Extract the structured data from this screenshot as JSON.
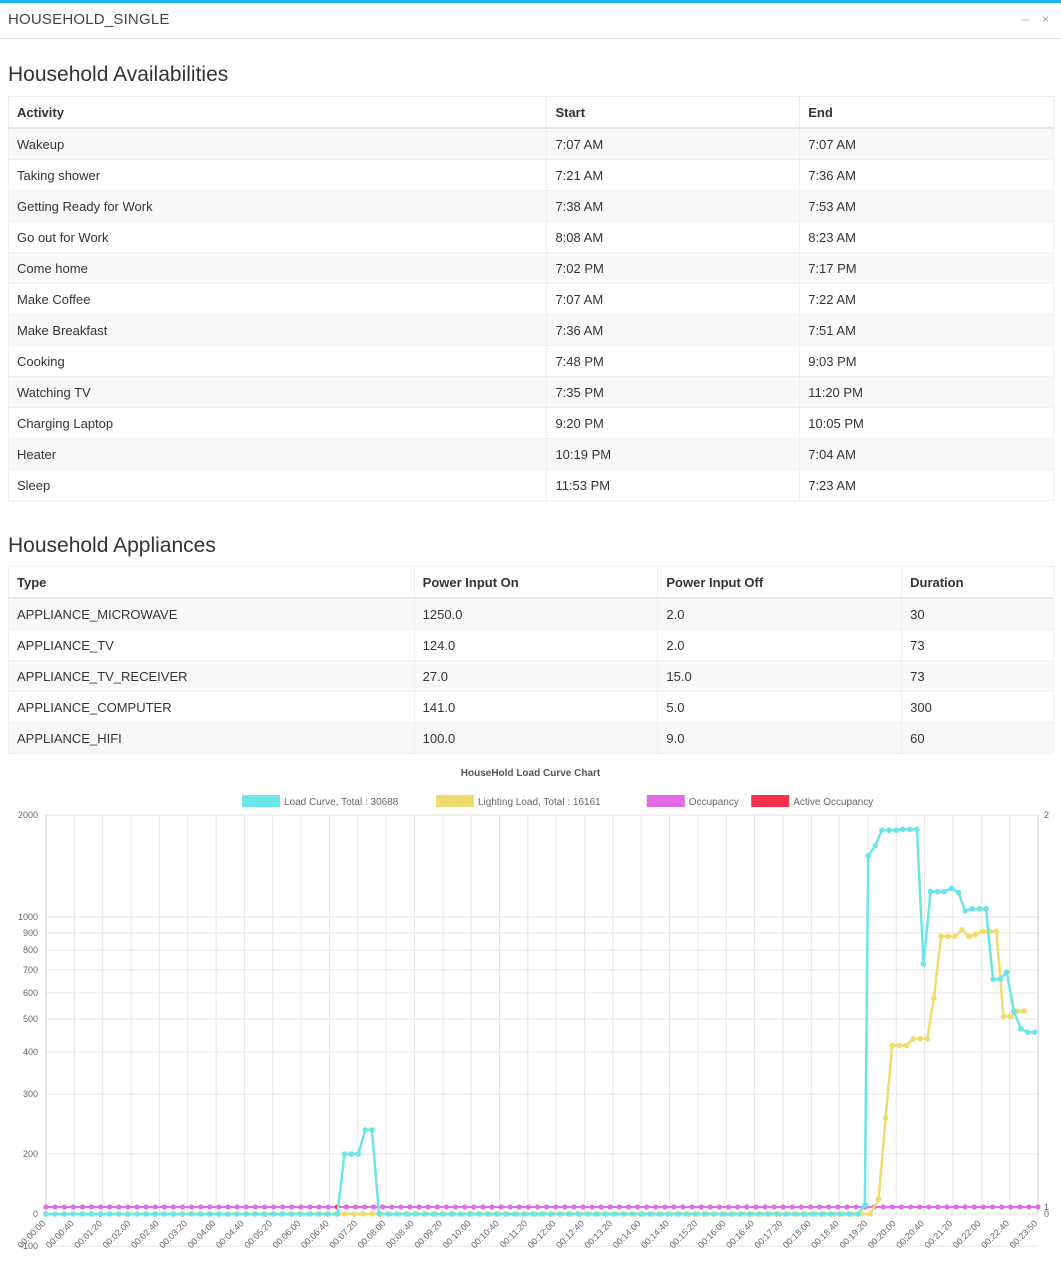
{
  "panel": {
    "title": "HOUSEHOLD_SINGLE",
    "minimize": "–",
    "close": "×"
  },
  "availabilities": {
    "heading": "Household Availabilities",
    "columns": [
      "Activity",
      "Start",
      "End"
    ],
    "rows": [
      [
        "Wakeup",
        "7:07 AM",
        "7:07 AM"
      ],
      [
        "Taking shower",
        "7:21 AM",
        "7:36 AM"
      ],
      [
        "Getting Ready for Work",
        "7:38 AM",
        "7:53 AM"
      ],
      [
        "Go out for Work",
        "8:08 AM",
        "8:23 AM"
      ],
      [
        "Come home",
        "7:02 PM",
        "7:17 PM"
      ],
      [
        "Make Coffee",
        "7:07 AM",
        "7:22 AM"
      ],
      [
        "Make Breakfast",
        "7:36 AM",
        "7:51 AM"
      ],
      [
        "Cooking",
        "7:48 PM",
        "9:03 PM"
      ],
      [
        "Watching TV",
        "7:35 PM",
        "11:20 PM"
      ],
      [
        "Charging Laptop",
        "9:20 PM",
        "10:05 PM"
      ],
      [
        "Heater",
        "10:19 PM",
        "7:04 AM"
      ],
      [
        "Sleep",
        "11:53 PM",
        "7:23 AM"
      ]
    ]
  },
  "appliances": {
    "heading": "Household Appliances",
    "columns": [
      "Type",
      "Power Input On",
      "Power Input Off",
      "Duration"
    ],
    "rows": [
      [
        "APPLIANCE_MICROWAVE",
        "1250.0",
        "2.0",
        "30"
      ],
      [
        "APPLIANCE_TV",
        "124.0",
        "2.0",
        "73"
      ],
      [
        "APPLIANCE_TV_RECEIVER",
        "27.0",
        "15.0",
        "73"
      ],
      [
        "APPLIANCE_COMPUTER",
        "141.0",
        "5.0",
        "300"
      ],
      [
        "APPLIANCE_HIFI",
        "100.0",
        "9.0",
        "60"
      ]
    ]
  },
  "chart_data": {
    "type": "line",
    "title": "HouseHold Load Curve Chart",
    "legend_placement": "top",
    "grid": true,
    "y_scale": "log-like",
    "y_ticks": [
      "2000",
      "1000",
      "900",
      "800",
      "700",
      "600",
      "500",
      "400",
      "300",
      "200",
      "0",
      "-100"
    ],
    "y_tick_values": [
      2000,
      1000,
      900,
      800,
      700,
      600,
      500,
      400,
      300,
      200,
      0,
      -100
    ],
    "y2_ticks": [
      "2",
      "1",
      "0"
    ],
    "x_ticks": [
      "00:00:00",
      "00:00:40",
      "00:01:20",
      "00:02:00",
      "00:02:40",
      "00:03:20",
      "00:04:00",
      "00:04:40",
      "00:05:20",
      "00:06:00",
      "00:06:40",
      "00:07:20",
      "00:08:00",
      "00:08:40",
      "00:09:20",
      "00:10:00",
      "00:10:40",
      "00:11:20",
      "00:12:00",
      "00:12:40",
      "00:13:20",
      "00:14:00",
      "00:14:40",
      "00:15:20",
      "00:16:00",
      "00:16:40",
      "00:17:20",
      "00:18:00",
      "00:18:40",
      "00:19:20",
      "00:20:00",
      "00:20:40",
      "00:21:20",
      "00:22:00",
      "00:22:40",
      "00:23:50"
    ],
    "x_range_minutes": [
      0,
      23.83
    ],
    "series": [
      {
        "name": "Load Curve, Total : 30688",
        "color": "#6ce5e8",
        "axis": "left",
        "points": [
          [
            0,
            0
          ],
          [
            7.0,
            0
          ],
          [
            7.17,
            200
          ],
          [
            7.33,
            200
          ],
          [
            7.5,
            200
          ],
          [
            7.67,
            240
          ],
          [
            7.83,
            240
          ],
          [
            8.0,
            0
          ],
          [
            19.5,
            0
          ],
          [
            19.67,
            30
          ],
          [
            19.75,
            1600
          ],
          [
            19.92,
            1700
          ],
          [
            20.08,
            1850
          ],
          [
            20.25,
            1850
          ],
          [
            20.42,
            1850
          ],
          [
            20.58,
            1860
          ],
          [
            20.75,
            1860
          ],
          [
            20.92,
            1860
          ],
          [
            21.08,
            730
          ],
          [
            21.25,
            1250
          ],
          [
            21.42,
            1250
          ],
          [
            21.58,
            1250
          ],
          [
            21.75,
            1280
          ],
          [
            21.92,
            1240
          ],
          [
            22.08,
            1060
          ],
          [
            22.25,
            1080
          ],
          [
            22.42,
            1080
          ],
          [
            22.58,
            1080
          ],
          [
            22.75,
            660
          ],
          [
            22.92,
            660
          ],
          [
            23.08,
            690
          ],
          [
            23.25,
            530
          ],
          [
            23.42,
            470
          ],
          [
            23.58,
            460
          ],
          [
            23.75,
            460
          ]
        ]
      },
      {
        "name": "Lighting Load, Total : 16161",
        "color": "#f0dc6e",
        "axis": "left",
        "points": [
          [
            0,
            0
          ],
          [
            19.8,
            0
          ],
          [
            20.0,
            50
          ],
          [
            20.17,
            260
          ],
          [
            20.33,
            420
          ],
          [
            20.5,
            420
          ],
          [
            20.67,
            420
          ],
          [
            20.83,
            440
          ],
          [
            21.0,
            440
          ],
          [
            21.17,
            440
          ],
          [
            21.33,
            580
          ],
          [
            21.5,
            880
          ],
          [
            21.67,
            880
          ],
          [
            21.83,
            880
          ],
          [
            22.0,
            920
          ],
          [
            22.17,
            880
          ],
          [
            22.33,
            890
          ],
          [
            22.5,
            910
          ],
          [
            22.67,
            910
          ],
          [
            22.83,
            910
          ],
          [
            23.0,
            510
          ],
          [
            23.17,
            510
          ],
          [
            23.33,
            530
          ],
          [
            23.5,
            530
          ]
        ]
      },
      {
        "name": "Occupancy",
        "color": "#e26ce8",
        "axis": "right",
        "value": 1
      },
      {
        "name": "Active Occupancy",
        "color": "#f5314e",
        "axis": "right",
        "value": 1
      }
    ]
  }
}
